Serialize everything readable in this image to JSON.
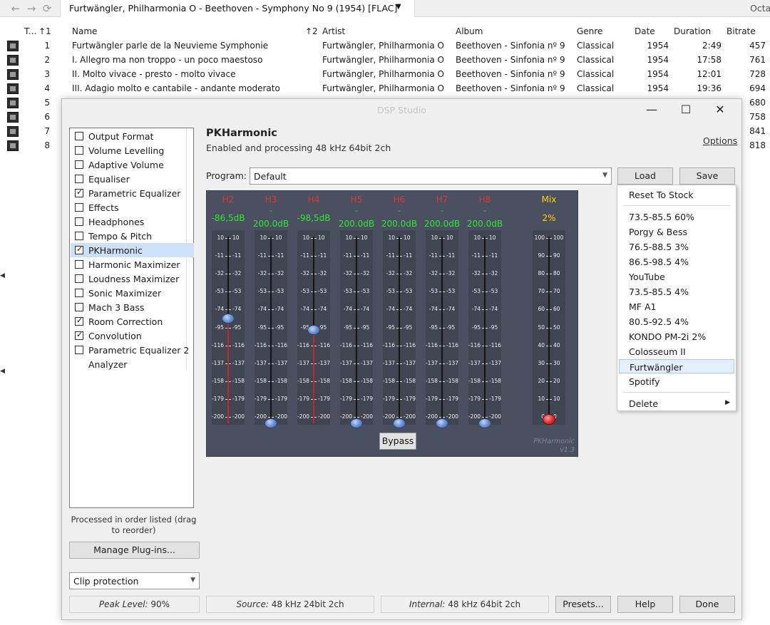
{
  "topbar": {
    "back_icon": "←",
    "forward_icon": "→",
    "refresh_icon": "⟳",
    "zone_title": "Furtwängler, Philharmonia O - Beethoven - Symphony No 9 (1954) [FLAC]",
    "zone_caret": "▼",
    "right_text": "Octa"
  },
  "track_list": {
    "columns": {
      "track": "T...",
      "track_sort": "↑1",
      "name": "Name",
      "name_sort": "↑2",
      "artist": "Artist",
      "album": "Album",
      "genre": "Genre",
      "date": "Date",
      "duration": "Duration",
      "bitrate": "Bitrate"
    },
    "rows": [
      {
        "n": "1",
        "name": "Furtwängler parle de la Neuvieme Symphonie",
        "artist": "Furtwängler, Philharmonia O",
        "album": "Beethoven - Sinfonia nº 9",
        "genre": "Classical",
        "date": "1954",
        "duration": "2:49",
        "bitrate": "457"
      },
      {
        "n": "2",
        "name": "I. Allegro ma non troppo - un poco maestoso",
        "artist": "Furtwängler, Philharmonia O",
        "album": "Beethoven - Sinfonia nº 9",
        "genre": "Classical",
        "date": "1954",
        "duration": "17:58",
        "bitrate": "761"
      },
      {
        "n": "3",
        "name": "II. Molto vivace - presto - molto vivace",
        "artist": "Furtwängler, Philharmonia O",
        "album": "Beethoven - Sinfonia nº 9",
        "genre": "Classical",
        "date": "1954",
        "duration": "12:01",
        "bitrate": "728"
      },
      {
        "n": "4",
        "name": "III. Adagio molto e cantabile - andante moderato",
        "artist": "Furtwängler, Philharmonia O",
        "album": "Beethoven - Sinfonia nº 9",
        "genre": "Classical",
        "date": "1954",
        "duration": "19:36",
        "bitrate": "694"
      },
      {
        "n": "5",
        "bitrate": "680"
      },
      {
        "n": "6",
        "bitrate": "758"
      },
      {
        "n": "7",
        "bitrate": "841"
      },
      {
        "n": "8",
        "bitrate": "818"
      }
    ]
  },
  "dsp": {
    "title": "DSP Studio",
    "minimize_glyph": "—",
    "maximize_glyph": "☐",
    "close_glyph": "✕",
    "plugins": [
      {
        "label": "Output Format",
        "checked": false
      },
      {
        "label": "Volume Levelling",
        "checked": false
      },
      {
        "label": "Adaptive Volume",
        "checked": false
      },
      {
        "label": "Equaliser",
        "checked": false
      },
      {
        "label": "Parametric Equalizer",
        "checked": true
      },
      {
        "label": "Effects",
        "checked": false
      },
      {
        "label": "Headphones",
        "checked": false
      },
      {
        "label": "Tempo & Pitch",
        "checked": false
      },
      {
        "label": "PKHarmonic",
        "checked": true,
        "selected": true
      },
      {
        "label": "Harmonic Maximizer",
        "checked": false
      },
      {
        "label": "Loudness Maximizer",
        "checked": false
      },
      {
        "label": "Sonic Maximizer",
        "checked": false
      },
      {
        "label": "Mach 3 Bass",
        "checked": false
      },
      {
        "label": "Room Correction",
        "checked": true
      },
      {
        "label": "Convolution",
        "checked": true
      },
      {
        "label": "Parametric Equalizer 2",
        "checked": false
      },
      {
        "label": "Analyzer",
        "checked": null
      }
    ],
    "processed_note": "Processed in order listed (drag to reorder)",
    "manage_plugins": "Manage Plug-ins...",
    "clip_protection": "Clip protection",
    "caret": "▼",
    "peak_level_label": "Peak Level:",
    "peak_level_value": "90%",
    "source_label": "Source:",
    "source_value": "48 kHz 24bit 2ch",
    "internal_label": "Internal:",
    "internal_value": "48 kHz 64bit 2ch",
    "presets_button": "Presets...",
    "help_button": "Help",
    "done_button": "Done",
    "plugin_name": "PKHarmonic",
    "plugin_status": "Enabled and processing 48 kHz 64bit 2ch",
    "options_link": "Options",
    "program_label": "Program:",
    "program_value": "Default",
    "load_button": "Load",
    "save_button": "Save"
  },
  "pk": {
    "channels": [
      {
        "label": "H2",
        "color": "#e03434",
        "dash": "",
        "value": "-86,5dB",
        "active": true,
        "level": 0.44
      },
      {
        "label": "H3",
        "color": "#e03434",
        "dash": "-",
        "value": "200.0dB",
        "active": false,
        "level": 1.0
      },
      {
        "label": "H4",
        "color": "#e03434",
        "dash": "",
        "value": "-98,5dB",
        "active": true,
        "level": 0.5
      },
      {
        "label": "H5",
        "color": "#e03434",
        "dash": "-",
        "value": "200.0dB",
        "active": false,
        "level": 1.0
      },
      {
        "label": "H6",
        "color": "#e03434",
        "dash": "-",
        "value": "200.0dB",
        "active": false,
        "level": 1.0
      },
      {
        "label": "H7",
        "color": "#e03434",
        "dash": "-",
        "value": "200.0dB",
        "active": false,
        "level": 1.0
      },
      {
        "label": "H8",
        "color": "#e03434",
        "dash": "-",
        "value": "200.0dB",
        "active": false,
        "level": 1.0
      }
    ],
    "ticks": [
      "10",
      "-11",
      "-32",
      "-53",
      "-74",
      "-95",
      "-116",
      "-137",
      "-158",
      "-179",
      "-200"
    ],
    "mix": {
      "label": "Mix",
      "label_color": "#ffd400",
      "value": "2%",
      "level_percent": 2,
      "ticks": [
        "100",
        "90",
        "80",
        "70",
        "60",
        "50",
        "40",
        "30",
        "20",
        "10",
        "0"
      ]
    },
    "bypass": "Bypass",
    "brand": "PKHarmonic",
    "version": "v1.3"
  },
  "menu": {
    "reset": "Reset To Stock",
    "presets": [
      "73.5-85.5 60%",
      "Porgy & Bess",
      "76.5-88.5 3%",
      "86.5-98.5 4%",
      "YouTube",
      "73.5-85.5 4%",
      "MF A1",
      "80.5-92.5 4%",
      "KONDO PM-2i 2%",
      "Colosseum II",
      "Furtwängler",
      "Spotify"
    ],
    "highlighted": "Furtwängler",
    "delete": "Delete",
    "submenu_arrow": "▶"
  }
}
